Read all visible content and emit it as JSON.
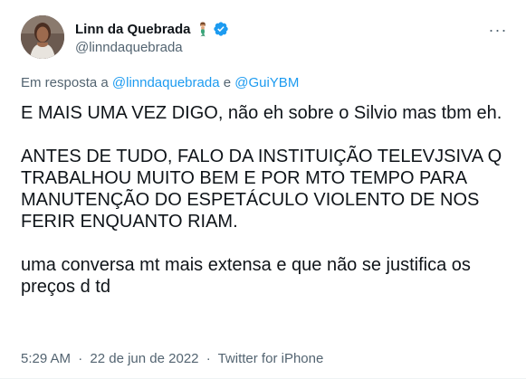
{
  "author": {
    "display_name": "Linn da Quebrada",
    "handle": "@linndaquebrada",
    "name_emoji": "mermaid-emoji-icon",
    "verified": true,
    "verified_color": "#1d9bf0"
  },
  "reply": {
    "prefix": "Em resposta a",
    "mention_1": "@linndaquebrada",
    "conjunction": "e",
    "mention_2": "@GuiYBM"
  },
  "tweet": {
    "paragraph_1": "E MAIS UMA VEZ DIGO, não eh sobre o Silvio mas tbm eh.",
    "paragraph_2": "ANTES DE TUDO, FALO DA INSTITUIÇÃO TELEVJSIVA Q TRABALHOU MUITO BEM E POR MTO TEMPO PARA MANUTENÇÃO DO ESPETÁCULO VIOLENTO DE NOS FERIR ENQUANTO RIAM.",
    "paragraph_3": "uma conversa mt mais extensa e que não se justifica os preços d td"
  },
  "meta": {
    "time": "5:29 AM",
    "separator": "·",
    "date": "22 de jun de 2022",
    "source": "Twitter for iPhone"
  },
  "colors": {
    "text": "#0f1419",
    "secondary": "#536471",
    "link": "#1d9bf0"
  },
  "icons": {
    "more": "more-horizontal-icon",
    "verified": "verified-badge-icon"
  }
}
